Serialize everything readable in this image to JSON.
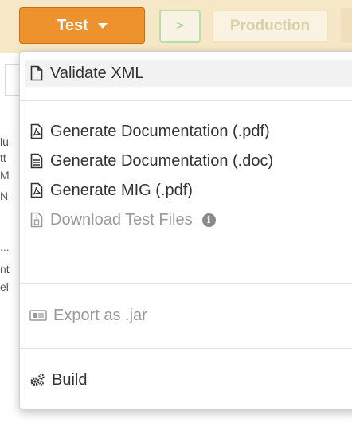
{
  "toolbar": {
    "test_button": "Test",
    "next_button": ">",
    "production_button": "Production"
  },
  "background_fragments": [
    "lu",
    "tt",
    "M",
    "N",
    "...",
    "nt",
    "el"
  ],
  "menu": {
    "items": [
      {
        "label": "Validate XML",
        "icon": "file-icon",
        "disabled": false
      },
      {
        "label": "Generate Documentation (.pdf)",
        "icon": "pdf-file-icon",
        "disabled": false
      },
      {
        "label": "Generate Documentation (.doc)",
        "icon": "doc-file-icon",
        "disabled": false
      },
      {
        "label": "Generate MIG (.pdf)",
        "icon": "pdf-file-icon",
        "disabled": false
      },
      {
        "label": "Download Test Files",
        "icon": "archive-file-icon",
        "disabled": true,
        "info_icon": "i"
      },
      {
        "label": "Export as .jar",
        "icon": "jar-icon",
        "disabled": true
      },
      {
        "label": "Build",
        "icon": "cogs-icon",
        "disabled": false
      }
    ]
  },
  "colors": {
    "accent": "#ee922e",
    "toolbar_bg": "#f6e7c7",
    "disabled_text": "#9a9a9a",
    "success_outline": "#b8e0a0"
  }
}
